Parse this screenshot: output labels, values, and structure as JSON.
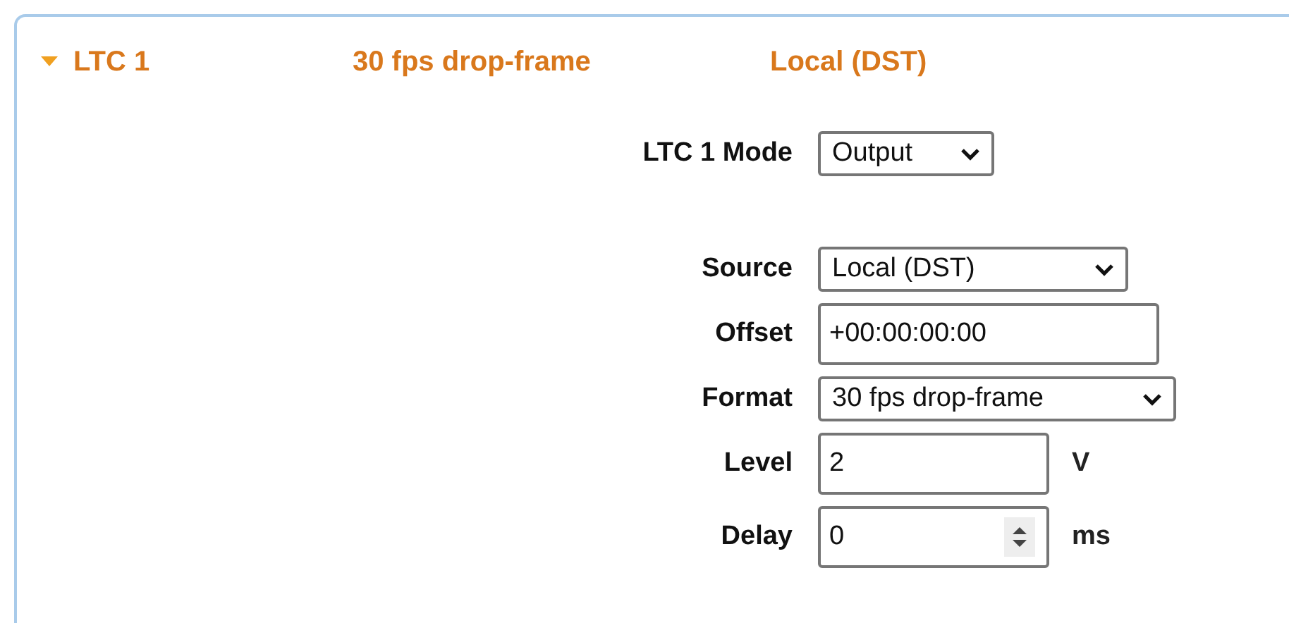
{
  "header": {
    "expanded": true,
    "title": "LTC 1",
    "format": "30 fps drop-frame",
    "source": "Local (DST)"
  },
  "mode": {
    "label": "LTC 1 Mode",
    "value": "Output"
  },
  "fields": [
    {
      "kind": "select",
      "label": "Source",
      "value": "Local (DST)"
    },
    {
      "kind": "text",
      "label": "Offset",
      "value": "+00:00:00:00"
    },
    {
      "kind": "select",
      "label": "Format",
      "value": "30 fps drop-frame"
    },
    {
      "kind": "text",
      "label": "Level",
      "value": "2",
      "unit": "V"
    },
    {
      "kind": "number",
      "label": "Delay",
      "value": "0",
      "unit": "ms"
    }
  ]
}
